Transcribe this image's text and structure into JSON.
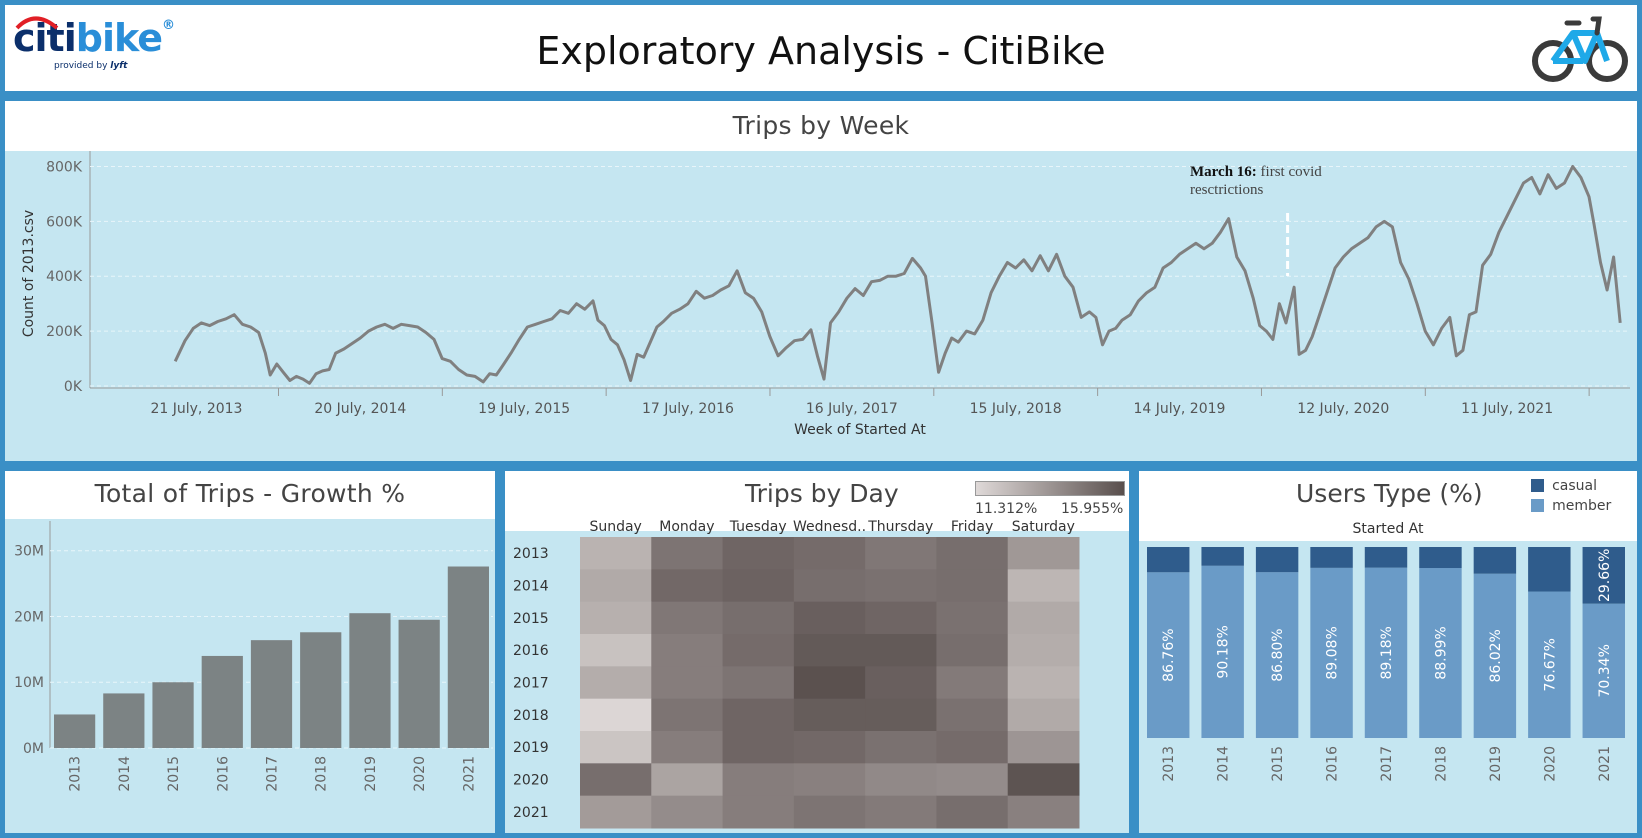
{
  "header": {
    "title": "Exploratory Analysis - CitiBike",
    "logo_word_1": "citi",
    "logo_word_2": "bike",
    "logo_reg": "®",
    "logo_sub": "provided by",
    "logo_sub_brand": "lyft"
  },
  "colors": {
    "frame": "#3a8fc6",
    "plot_bg": "#c5e6f1",
    "line": "#808080",
    "bar": "#7c8384",
    "member": "#6a9bc7",
    "casual": "#2f5c8c",
    "heat_low": "#dfd9d8",
    "heat_high": "#594f4d",
    "logo_blue": "#2a8ed8",
    "logo_navy": "#0b2f6b",
    "logo_red": "#e11f26"
  },
  "trips_by_week": {
    "title": "Trips by Week",
    "annotation_bold": "March 16:",
    "annotation_line1": " first covid",
    "annotation_line2": "resctrictions",
    "chart_data": {
      "type": "line",
      "title": "Trips by Week",
      "xlabel": "Week of Started At",
      "ylabel": "Count of 2013.csv",
      "ylim": [
        0,
        820000
      ],
      "y_ticks": [
        "0K",
        "200K",
        "400K",
        "600K",
        "800K"
      ],
      "x_ticks": [
        "21 July, 2013",
        "20 July, 2014",
        "19 July, 2015",
        "17 July, 2016",
        "16 July, 2017",
        "15 July, 2018",
        "14 July, 2019",
        "12 July, 2020",
        "11 July, 2021"
      ],
      "x_range_years": [
        2012.9,
        2022.3
      ],
      "annotation_x_year": 2020.21,
      "grid": true,
      "series": [
        {
          "values": [
            [
              2013.42,
              90000
            ],
            [
              2013.48,
              165000
            ],
            [
              2013.53,
              210000
            ],
            [
              2013.58,
              230000
            ],
            [
              2013.63,
              220000
            ],
            [
              2013.68,
              235000
            ],
            [
              2013.73,
              245000
            ],
            [
              2013.78,
              260000
            ],
            [
              2013.83,
              225000
            ],
            [
              2013.88,
              215000
            ],
            [
              2013.93,
              195000
            ],
            [
              2013.97,
              120000
            ],
            [
              2014.0,
              40000
            ],
            [
              2014.04,
              80000
            ],
            [
              2014.08,
              50000
            ],
            [
              2014.12,
              20000
            ],
            [
              2014.16,
              35000
            ],
            [
              2014.2,
              25000
            ],
            [
              2014.24,
              10000
            ],
            [
              2014.28,
              45000
            ],
            [
              2014.32,
              55000
            ],
            [
              2014.36,
              60000
            ],
            [
              2014.4,
              120000
            ],
            [
              2014.45,
              135000
            ],
            [
              2014.5,
              155000
            ],
            [
              2014.55,
              175000
            ],
            [
              2014.6,
              200000
            ],
            [
              2014.65,
              215000
            ],
            [
              2014.7,
              225000
            ],
            [
              2014.75,
              210000
            ],
            [
              2014.8,
              225000
            ],
            [
              2014.85,
              220000
            ],
            [
              2014.9,
              215000
            ],
            [
              2014.95,
              195000
            ],
            [
              2015.0,
              170000
            ],
            [
              2015.05,
              100000
            ],
            [
              2015.1,
              90000
            ],
            [
              2015.15,
              60000
            ],
            [
              2015.2,
              40000
            ],
            [
              2015.25,
              35000
            ],
            [
              2015.3,
              15000
            ],
            [
              2015.34,
              45000
            ],
            [
              2015.38,
              40000
            ],
            [
              2015.42,
              75000
            ],
            [
              2015.47,
              120000
            ],
            [
              2015.52,
              170000
            ],
            [
              2015.57,
              215000
            ],
            [
              2015.62,
              225000
            ],
            [
              2015.67,
              235000
            ],
            [
              2015.72,
              245000
            ],
            [
              2015.77,
              275000
            ],
            [
              2015.82,
              265000
            ],
            [
              2015.87,
              300000
            ],
            [
              2015.92,
              280000
            ],
            [
              2015.97,
              310000
            ],
            [
              2016.0,
              240000
            ],
            [
              2016.04,
              220000
            ],
            [
              2016.08,
              170000
            ],
            [
              2016.12,
              150000
            ],
            [
              2016.16,
              95000
            ],
            [
              2016.2,
              20000
            ],
            [
              2016.24,
              115000
            ],
            [
              2016.28,
              105000
            ],
            [
              2016.32,
              160000
            ],
            [
              2016.36,
              215000
            ],
            [
              2016.4,
              235000
            ],
            [
              2016.45,
              265000
            ],
            [
              2016.5,
              280000
            ],
            [
              2016.55,
              300000
            ],
            [
              2016.6,
              345000
            ],
            [
              2016.65,
              320000
            ],
            [
              2016.7,
              330000
            ],
            [
              2016.75,
              350000
            ],
            [
              2016.8,
              365000
            ],
            [
              2016.85,
              420000
            ],
            [
              2016.9,
              340000
            ],
            [
              2016.95,
              320000
            ],
            [
              2017.0,
              270000
            ],
            [
              2017.05,
              180000
            ],
            [
              2017.1,
              110000
            ],
            [
              2017.15,
              140000
            ],
            [
              2017.2,
              165000
            ],
            [
              2017.25,
              170000
            ],
            [
              2017.3,
              205000
            ],
            [
              2017.34,
              110000
            ],
            [
              2017.38,
              25000
            ],
            [
              2017.42,
              230000
            ],
            [
              2017.47,
              270000
            ],
            [
              2017.52,
              320000
            ],
            [
              2017.57,
              355000
            ],
            [
              2017.62,
              330000
            ],
            [
              2017.67,
              380000
            ],
            [
              2017.72,
              385000
            ],
            [
              2017.77,
              400000
            ],
            [
              2017.82,
              400000
            ],
            [
              2017.87,
              410000
            ],
            [
              2017.92,
              465000
            ],
            [
              2017.97,
              430000
            ],
            [
              2018.0,
              400000
            ],
            [
              2018.04,
              230000
            ],
            [
              2018.08,
              50000
            ],
            [
              2018.12,
              120000
            ],
            [
              2018.16,
              175000
            ],
            [
              2018.2,
              160000
            ],
            [
              2018.25,
              200000
            ],
            [
              2018.3,
              190000
            ],
            [
              2018.35,
              240000
            ],
            [
              2018.4,
              340000
            ],
            [
              2018.45,
              400000
            ],
            [
              2018.5,
              450000
            ],
            [
              2018.55,
              430000
            ],
            [
              2018.6,
              460000
            ],
            [
              2018.65,
              420000
            ],
            [
              2018.7,
              475000
            ],
            [
              2018.75,
              420000
            ],
            [
              2018.8,
              480000
            ],
            [
              2018.85,
              400000
            ],
            [
              2018.9,
              360000
            ],
            [
              2018.95,
              250000
            ],
            [
              2019.0,
              270000
            ],
            [
              2019.04,
              250000
            ],
            [
              2019.08,
              150000
            ],
            [
              2019.12,
              200000
            ],
            [
              2019.16,
              210000
            ],
            [
              2019.2,
              240000
            ],
            [
              2019.25,
              260000
            ],
            [
              2019.3,
              310000
            ],
            [
              2019.35,
              340000
            ],
            [
              2019.4,
              360000
            ],
            [
              2019.45,
              430000
            ],
            [
              2019.5,
              450000
            ],
            [
              2019.55,
              480000
            ],
            [
              2019.6,
              500000
            ],
            [
              2019.65,
              520000
            ],
            [
              2019.7,
              500000
            ],
            [
              2019.75,
              520000
            ],
            [
              2019.8,
              560000
            ],
            [
              2019.85,
              610000
            ],
            [
              2019.9,
              470000
            ],
            [
              2019.95,
              420000
            ],
            [
              2020.0,
              320000
            ],
            [
              2020.04,
              220000
            ],
            [
              2020.08,
              200000
            ],
            [
              2020.12,
              170000
            ],
            [
              2020.16,
              300000
            ],
            [
              2020.2,
              230000
            ],
            [
              2020.25,
              360000
            ],
            [
              2020.28,
              115000
            ],
            [
              2020.32,
              130000
            ],
            [
              2020.36,
              180000
            ],
            [
              2020.4,
              250000
            ],
            [
              2020.45,
              340000
            ],
            [
              2020.5,
              430000
            ],
            [
              2020.55,
              470000
            ],
            [
              2020.6,
              500000
            ],
            [
              2020.65,
              520000
            ],
            [
              2020.7,
              540000
            ],
            [
              2020.75,
              580000
            ],
            [
              2020.8,
              600000
            ],
            [
              2020.85,
              580000
            ],
            [
              2020.9,
              450000
            ],
            [
              2020.95,
              390000
            ],
            [
              2021.0,
              300000
            ],
            [
              2021.05,
              200000
            ],
            [
              2021.1,
              150000
            ],
            [
              2021.15,
              210000
            ],
            [
              2021.2,
              250000
            ],
            [
              2021.24,
              110000
            ],
            [
              2021.28,
              130000
            ],
            [
              2021.32,
              260000
            ],
            [
              2021.36,
              270000
            ],
            [
              2021.4,
              440000
            ],
            [
              2021.45,
              480000
            ],
            [
              2021.5,
              560000
            ],
            [
              2021.55,
              620000
            ],
            [
              2021.6,
              680000
            ],
            [
              2021.65,
              740000
            ],
            [
              2021.7,
              760000
            ],
            [
              2021.75,
              700000
            ],
            [
              2021.8,
              770000
            ],
            [
              2021.85,
              720000
            ],
            [
              2021.9,
              740000
            ],
            [
              2021.95,
              800000
            ],
            [
              2022.0,
              760000
            ],
            [
              2022.05,
              690000
            ],
            [
              2022.08,
              590000
            ],
            [
              2022.12,
              450000
            ],
            [
              2022.16,
              350000
            ],
            [
              2022.2,
              470000
            ],
            [
              2022.24,
              230000
            ]
          ]
        }
      ]
    }
  },
  "growth": {
    "title": "Total of Trips - Growth %",
    "chart_data": {
      "type": "bar",
      "title": "Total of Trips - Growth %",
      "categories": [
        "2013",
        "2014",
        "2015",
        "2016",
        "2017",
        "2018",
        "2019",
        "2020",
        "2021"
      ],
      "values": [
        5100000,
        8300000,
        10000000,
        14000000,
        16400000,
        17600000,
        20500000,
        19500000,
        27600000
      ],
      "ylim": [
        0,
        33000000
      ],
      "y_ticks": [
        "0M",
        "10M",
        "20M",
        "30M"
      ],
      "grid": true
    }
  },
  "trips_by_day": {
    "title": "Trips by Day",
    "legend_min": "11.312%",
    "legend_max": "15.955%",
    "chart_data": {
      "type": "heatmap",
      "title": "Trips by Day",
      "columns": [
        "Sunday",
        "Monday",
        "Tuesday",
        "Wednesd..",
        "Thursday",
        "Friday",
        "Saturday"
      ],
      "rows": [
        "2013",
        "2014",
        "2015",
        "2016",
        "2017",
        "2018",
        "2019",
        "2020",
        "2021"
      ],
      "color_range": [
        11.312,
        15.955
      ],
      "values": [
        [
          12.6,
          14.7,
          15.2,
          15.0,
          14.6,
          14.9,
          13.5
        ],
        [
          12.9,
          15.1,
          15.3,
          14.9,
          14.8,
          14.9,
          12.5
        ],
        [
          12.7,
          14.6,
          14.9,
          15.4,
          15.2,
          14.8,
          12.9
        ],
        [
          12.1,
          14.4,
          15.0,
          15.6,
          15.6,
          14.9,
          12.8
        ],
        [
          12.8,
          14.4,
          14.7,
          15.9,
          15.4,
          14.5,
          12.6
        ],
        [
          11.4,
          14.7,
          15.2,
          15.5,
          15.5,
          14.8,
          12.9
        ],
        [
          12.0,
          14.4,
          15.2,
          15.1,
          14.8,
          15.0,
          13.6
        ],
        [
          14.9,
          13.1,
          14.4,
          14.3,
          14.0,
          13.9,
          15.8
        ],
        [
          13.4,
          13.9,
          14.4,
          14.7,
          14.5,
          14.9,
          14.3
        ]
      ]
    }
  },
  "users_type": {
    "title": "Users Type (%)",
    "subtitle": "Started At",
    "legend": [
      {
        "name": "casual",
        "color": "#2f5c8c"
      },
      {
        "name": "member",
        "color": "#6a9bc7"
      }
    ],
    "chart_data": {
      "type": "bar",
      "title": "Users Type (%)",
      "xlabel": "Started At",
      "stacked": true,
      "categories": [
        "2013",
        "2014",
        "2015",
        "2016",
        "2017",
        "2018",
        "2019",
        "2020",
        "2021"
      ],
      "series": [
        {
          "name": "member",
          "values": [
            86.76,
            90.18,
            86.8,
            89.08,
            89.18,
            88.99,
            86.02,
            76.67,
            70.34
          ],
          "labels": [
            "86.76%",
            "90.18%",
            "86.80%",
            "89.08%",
            "89.18%",
            "88.99%",
            "86.02%",
            "76.67%",
            "70.34%"
          ]
        },
        {
          "name": "casual",
          "values": [
            13.24,
            9.82,
            13.2,
            10.92,
            10.82,
            11.01,
            13.98,
            23.33,
            29.66
          ],
          "labels": [
            "",
            "",
            "",
            "",
            "",
            "",
            "",
            "",
            "29.66%"
          ]
        }
      ],
      "ylim": [
        0,
        100
      ]
    }
  }
}
